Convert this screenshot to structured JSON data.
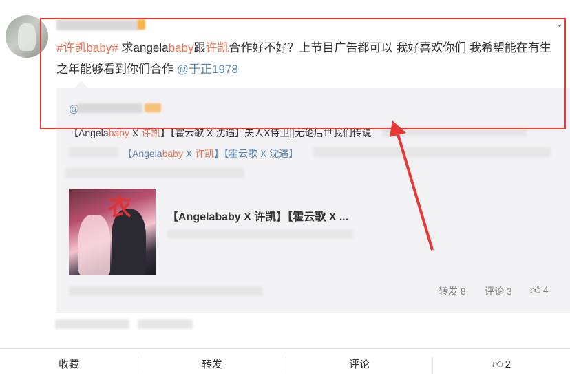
{
  "post": {
    "tag_hash_open": "#",
    "tag_text": "许凯baby",
    "tag_hash_close": "#",
    "text_part1": " 求angela",
    "text_hl1": "baby",
    "text_part2": "跟",
    "text_hl2": "许凯",
    "text_part3": "合作好不好？上节目广告都可以 我好喜欢你们 我希望能在有生之年能够看到你们合作 ",
    "mention": "@于正1978"
  },
  "quote": {
    "at": "@",
    "line1_a": "【Angela",
    "line1_hl1": "baby",
    "line1_b": " X ",
    "line1_hl2": "许凯",
    "line1_c": "】【霍云歌 X 沈遇】夫人X侍卫||无论后世我们传说",
    "line2_a": "【Angela",
    "line2_hl1": "baby",
    "line2_b": " X ",
    "line2_hl2": "许凯",
    "line2_c": "】【霍云歌 X 沈遇】",
    "card_title": "【Angelababy X 许凯】【霍云歌 X ..."
  },
  "quote_stats": {
    "forward": "转发 8",
    "comment": "评论 3",
    "like_icon": "thumbs-up-icon",
    "like_count": "4"
  },
  "actions": {
    "collect": "收藏",
    "forward": "转发",
    "comment": "评论",
    "like_icon": "thumbs-up-icon",
    "like_count": "2"
  },
  "colors": {
    "highlight": "#eb7350",
    "link": "#5b89b4",
    "annotation_red": "#e53935",
    "quote_bg": "#f2f2f5"
  }
}
